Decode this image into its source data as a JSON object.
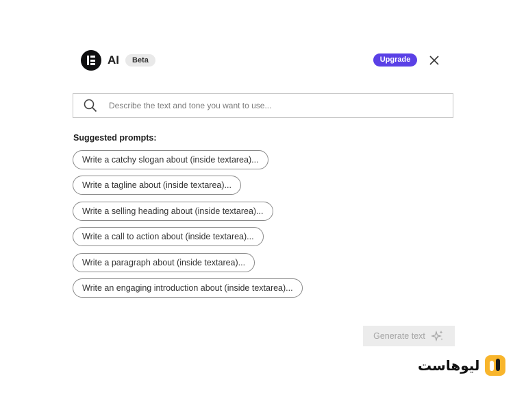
{
  "header": {
    "title": "AI",
    "badge": "Beta",
    "upgrade_label": "Upgrade",
    "logo_icon": "elementor-logo-icon",
    "close_icon": "close-icon"
  },
  "search": {
    "placeholder": "Describe the text and tone you want to use...",
    "value": "",
    "icon": "search-icon"
  },
  "suggestions": {
    "title": "Suggested prompts:",
    "items": [
      "Write a catchy slogan about (inside textarea)...",
      "Write a tagline about (inside textarea)...",
      "Write a selling heading about (inside textarea)...",
      "Write a call to action about (inside textarea)...",
      "Write a paragraph about (inside textarea)...",
      "Write an engaging introduction about (inside textarea)..."
    ]
  },
  "actions": {
    "generate_label": "Generate text",
    "generate_icon": "sparkle-icon"
  },
  "watermark": {
    "text": "لیوهاست"
  },
  "colors": {
    "accent": "#5a40e6",
    "logo": "#0f0f10",
    "brand_mark": "#f8b52c"
  }
}
